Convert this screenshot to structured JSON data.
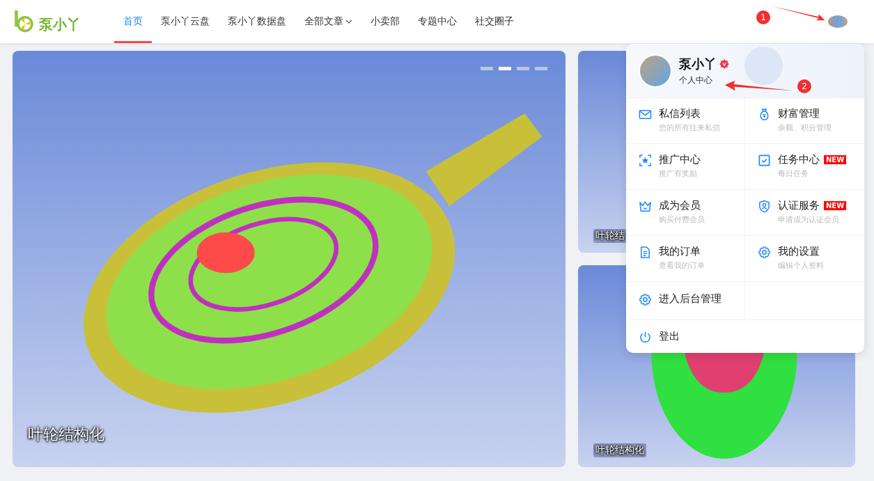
{
  "header": {
    "logo_text": "泵小丫",
    "nav": [
      {
        "label": "首页",
        "selected": true,
        "dropdown": false
      },
      {
        "label": "泵小丫云盘",
        "selected": false,
        "dropdown": false
      },
      {
        "label": "泵小丫数据盘",
        "selected": false,
        "dropdown": false
      },
      {
        "label": "全部文章",
        "selected": false,
        "dropdown": true
      },
      {
        "label": "小卖部",
        "selected": false,
        "dropdown": false
      },
      {
        "label": "专题中心",
        "selected": false,
        "dropdown": false
      },
      {
        "label": "社交圈子",
        "selected": false,
        "dropdown": false
      }
    ]
  },
  "slider": {
    "caption": "叶轮结构化",
    "dots": [
      {
        "selected": false
      },
      {
        "selected": true
      },
      {
        "selected": false
      },
      {
        "selected": false
      }
    ]
  },
  "side_cards": [
    {
      "caption": "叶轮结"
    },
    {
      "caption": "叶轮结构化"
    }
  ],
  "user_menu": {
    "name": "泵小丫",
    "verified": true,
    "link": "个人中心",
    "items": [
      {
        "title": "私信列表",
        "subtitle": "您的所有往来私信"
      },
      {
        "title": "财富管理",
        "subtitle": "余额、积分管理"
      },
      {
        "title": "推广中心",
        "subtitle": "推广有奖励"
      },
      {
        "title": "任务中心",
        "subtitle": "每日任务",
        "badge": "NEW"
      },
      {
        "title": "成为会员",
        "subtitle": "购买付费会员"
      },
      {
        "title": "认证服务",
        "subtitle": "申请成为认证会员",
        "badge": "NEW"
      },
      {
        "title": "我的订单",
        "subtitle": "查看我的订单"
      },
      {
        "title": "我的设置",
        "subtitle": "编辑个人资料"
      },
      {
        "title": "进入后台管理"
      }
    ],
    "logout": "登出"
  },
  "annotations": [
    {
      "label": "1"
    },
    {
      "label": "2"
    }
  ]
}
